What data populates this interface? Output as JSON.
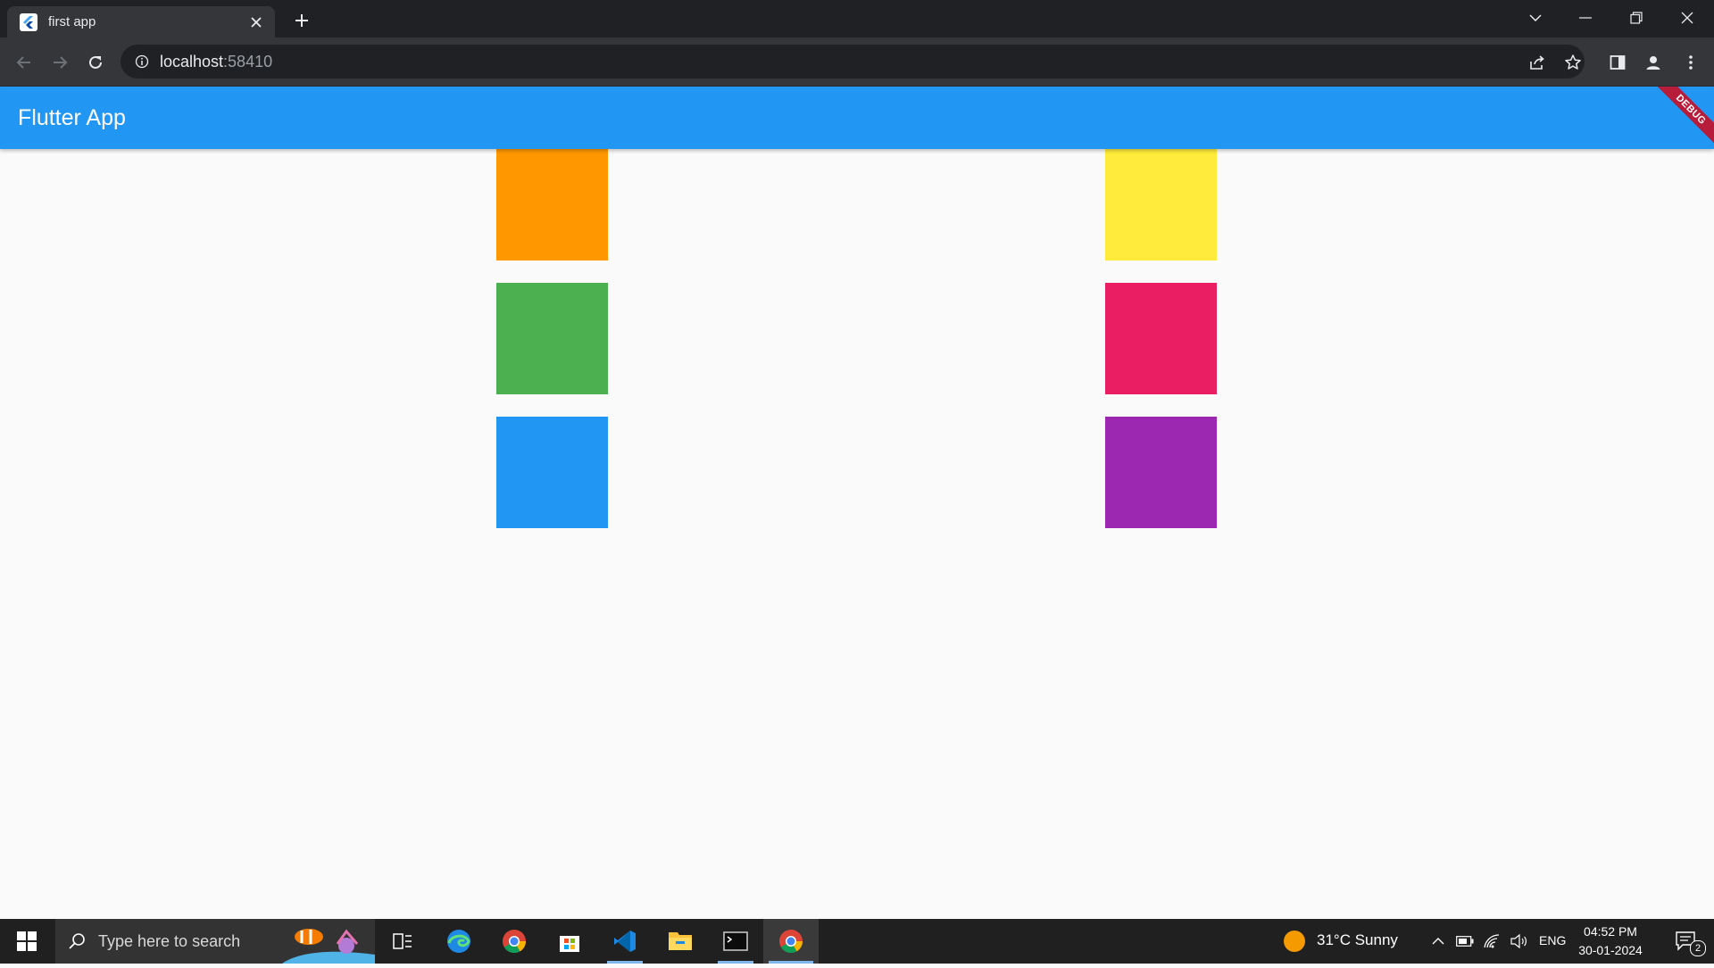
{
  "browser": {
    "tab_title": "first app",
    "url_host": "localhost",
    "url_port": ":58410"
  },
  "app": {
    "title": "Flutter App",
    "debug_banner": "DEBUG",
    "appbar_color": "#2196f3",
    "boxes": [
      {
        "color": "#ff9800",
        "name": "orange"
      },
      {
        "color": "#ffeb3b",
        "name": "yellow"
      },
      {
        "color": "#4caf50",
        "name": "green"
      },
      {
        "color": "#e91e63",
        "name": "pink"
      },
      {
        "color": "#2196f3",
        "name": "blue"
      },
      {
        "color": "#9c27b0",
        "name": "purple"
      }
    ]
  },
  "taskbar": {
    "search_placeholder": "Type here to search",
    "weather": "31°C  Sunny",
    "language": "ENG",
    "time": "04:52 PM",
    "date": "30-01-2024",
    "notification_count": "2"
  }
}
